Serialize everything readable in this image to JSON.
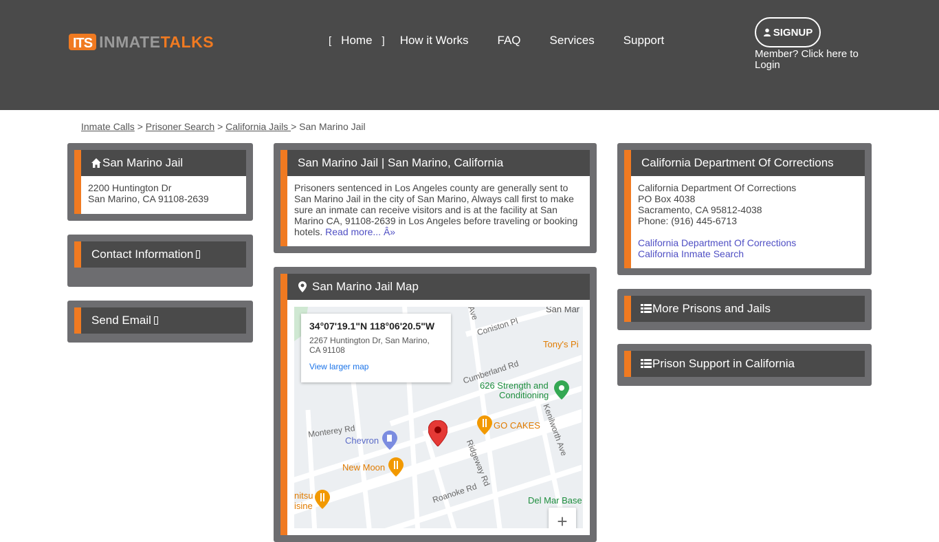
{
  "logo": {
    "its": "ITS",
    "word1": "INMATE",
    "word2": "TALKS"
  },
  "nav": {
    "bracket_open": "[",
    "bracket_close": "]",
    "items": [
      "Home",
      "How it Works",
      "FAQ",
      "Services",
      "Support"
    ]
  },
  "signup": {
    "label": "SIGNUP",
    "login_text": "Member? Click here to Login"
  },
  "breadcrumb": {
    "items": [
      "Inmate Calls",
      "Prisoner Search",
      "California Jails "
    ],
    "separator": ">",
    "current": "San Marino Jail"
  },
  "left": {
    "jail": {
      "title": "San Marino Jail",
      "address_line1": "2200 Huntington Dr",
      "address_line2": "San Marino, CA 91108-2639"
    },
    "contact": {
      "title": "Contact Information"
    },
    "email": {
      "title": "Send Email"
    }
  },
  "center": {
    "info": {
      "title": "San Marino Jail | San Marino, California",
      "text": "Prisoners sentenced in Los Angeles county are generally sent to San Marino Jail in the city of San Marino, Always call first to make sure an inmate can receive visitors and is at the facility at San Marino CA, 91108-2639 in Los Angeles before traveling or booking hotels.",
      "read_more": "Read more... Â»"
    },
    "map": {
      "title": "San Marino Jail Map",
      "coords": "34°07'19.1\"N 118°06'20.5\"W",
      "address": "2267 Huntington Dr, San Marino, CA 91108",
      "view_larger": "View larger map",
      "labels": {
        "san_mar": "San Mar",
        "coniston": "Coniston Pl",
        "tonys": "Tony's Pi",
        "cumberland": "Cumberland Rd",
        "strength": "626 Strength and",
        "conditioning": "Conditioning",
        "monterey": "Monterey Rd",
        "chevron": "Chevron",
        "gocakes": "GO CAKES",
        "kenilworth": "Kenilworth Ave",
        "ridgeway": "Ridgeway Rd",
        "newmoon": "New Moon",
        "roanoke": "Roanoke Rd",
        "nitsu1": "nitsu",
        "nitsu2": "isine",
        "delmar": "Del Mar Base",
        "ave": "Ave"
      },
      "zoom_in": "+"
    }
  },
  "right": {
    "cdc": {
      "title": "California Department Of Corrections",
      "lines": [
        "California Department Of Corrections",
        "PO Box 4038",
        "Sacramento, CA 95812-4038",
        "Phone: (916) 445-6713"
      ],
      "links": [
        "California Department Of Corrections",
        "California Inmate Search"
      ]
    },
    "more": {
      "title": "More Prisons and Jails"
    },
    "support": {
      "title": "Prison Support in California"
    }
  },
  "colors": {
    "header_bg": "#4a4a4a",
    "accent": "#f07a21",
    "widget_bg": "#6d6d70",
    "link": "#4f4fc4"
  }
}
